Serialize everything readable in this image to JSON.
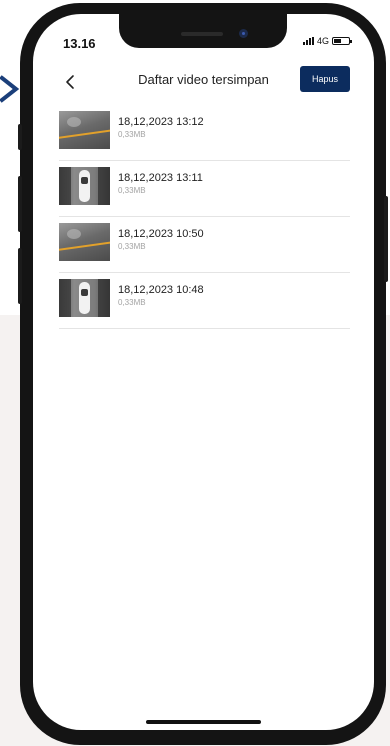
{
  "status_bar": {
    "time": "13.16",
    "network": "4G"
  },
  "header": {
    "title": "Daftar video tersimpan",
    "delete_label": "Hapus"
  },
  "videos": [
    {
      "date": "18,12,2023 13:12",
      "size": "0,33MB",
      "thumbnail": "road-view"
    },
    {
      "date": "18,12,2023 13:11",
      "size": "0,33MB",
      "thumbnail": "car-top-view"
    },
    {
      "date": "18,12,2023 10:50",
      "size": "0,33MB",
      "thumbnail": "road-view"
    },
    {
      "date": "18,12,2023 10:48",
      "size": "0,33MB",
      "thumbnail": "car-top-view"
    }
  ],
  "colors": {
    "accent": "#0c2c5e",
    "arrow": "#1b3f7a",
    "divider": "#e4e4e4"
  }
}
